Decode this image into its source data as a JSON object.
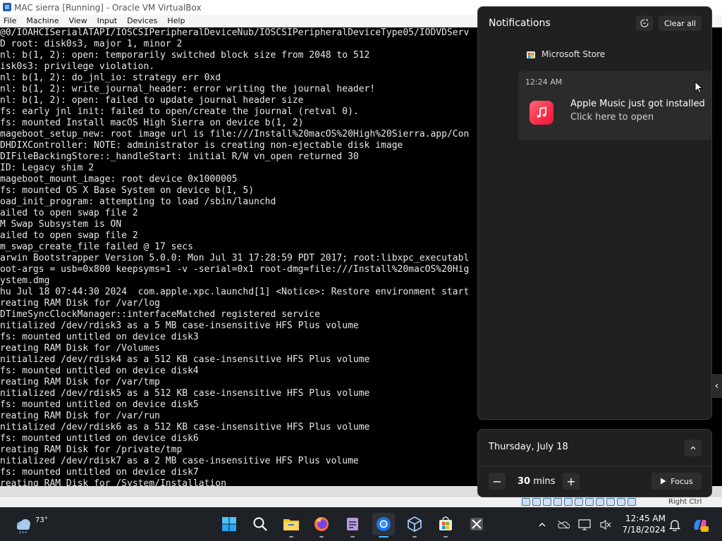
{
  "vbox": {
    "title": "MAC sierra [Running] - Oracle VM VirtualBox",
    "menu": [
      "File",
      "Machine",
      "View",
      "Input",
      "Devices",
      "Help"
    ],
    "host_key_label": "Right Ctrl",
    "console_lines": [
      "@0/IOAHCISerialATAPI/IOSCSIPeripheralDeviceNub/IOSCSIPeripheralDeviceType05/IODVDServ",
      "D root: disk0s3, major 1, minor 2",
      "nl: b(1, 2): open: temporarily switched block size from 2048 to 512",
      "isk0s3: privilege violation.",
      "nl: b(1, 2): do_jnl_io: strategy err 0xd",
      "nl: b(1, 2): write_journal_header: error writing the journal header!",
      "nl: b(1, 2): open: failed to update journal header size",
      "fs: early jnl init: failed to open/create the journal (retval 0).",
      "fs: mounted Install macOS High Sierra on device b(1, 2)",
      "mageboot_setup_new: root image url is file:///Install%20macOS%20High%20Sierra.app/Con",
      "DHDIXController: NOTE: administrator is creating non-ejectable disk image",
      "DIFileBackingStore::_handleStart: initial R/W vn_open returned 30",
      "ID: Legacy shim 2",
      "mageboot_mount_image: root device 0x1000005",
      "fs: mounted OS X Base System on device b(1, 5)",
      "oad_init_program: attempting to load /sbin/launchd",
      "ailed to open swap file 2",
      "M Swap Subsystem is ON",
      "ailed to open swap file 2",
      "m_swap_create_file failed @ 17 secs",
      "arwin Bootstrapper Version 5.0.0: Mon Jul 31 17:28:59 PDT 2017; root:libxpc_executabl",
      "oot-args = usb=0x800 keepsyms=1 -v -serial=0x1 root-dmg=file:///Install%20macOS%20Hig",
      "ystem.dmg",
      "hu Jul 18 07:44:30 2024  com.apple.xpc.launchd[1] <Notice>: Restore environment start",
      "reating RAM Disk for /var/log",
      "DTimeSyncClockManager::interfaceMatched registered service",
      "nitialized /dev/rdisk3 as a 5 MB case-insensitive HFS Plus volume",
      "fs: mounted untitled on device disk3",
      "reating RAM Disk for /Volumes",
      "nitialized /dev/rdisk4 as a 512 KB case-insensitive HFS Plus volume",
      "fs: mounted untitled on device disk4",
      "reating RAM Disk for /var/tmp",
      "nitialized /dev/rdisk5 as a 512 KB case-insensitive HFS Plus volume",
      "fs: mounted untitled on device disk5",
      "reating RAM Disk for /var/run",
      "nitialized /dev/rdisk6 as a 512 KB case-insensitive HFS Plus volume",
      "fs: mounted untitled on device disk6",
      "reating RAM Disk for /private/tmp",
      "nitialized /dev/rdisk7 as a 2 MB case-insensitive HFS Plus volume",
      "fs: mounted untitled on device disk7",
      "reating RAM Disk for /System/Installation"
    ]
  },
  "notifications": {
    "header": "Notifications",
    "clear_all": "Clear all",
    "dnd_icon": "dnd-icon",
    "group_name": "Microsoft Store",
    "toast": {
      "time": "12:24 AM",
      "title": "Apple Music just got installed",
      "subtitle": "Click here to open",
      "icon": "music-note-icon",
      "icon_color": "#fa2d48"
    }
  },
  "calendar": {
    "date": "Thursday, July 18",
    "focus_minutes": "30",
    "focus_unit": "mins",
    "focus_label": "Focus",
    "decrease": "−",
    "increase": "+"
  },
  "taskbar": {
    "weather_temp": "73°",
    "apps": [
      "start-icon",
      "search-icon",
      "file-explorer-icon",
      "firefox-icon",
      "notepad-icon",
      "chrome-icon",
      "virtualbox-icon",
      "microsoft-store-icon",
      "snipping-tool-icon"
    ],
    "clock_time": "12:45 AM",
    "clock_date": "7/18/2024"
  },
  "colors": {
    "panel_bg": "#202020",
    "card_bg": "#2b2b2b",
    "taskbar_bg": "#1e2126",
    "accent": "#0078d4"
  }
}
